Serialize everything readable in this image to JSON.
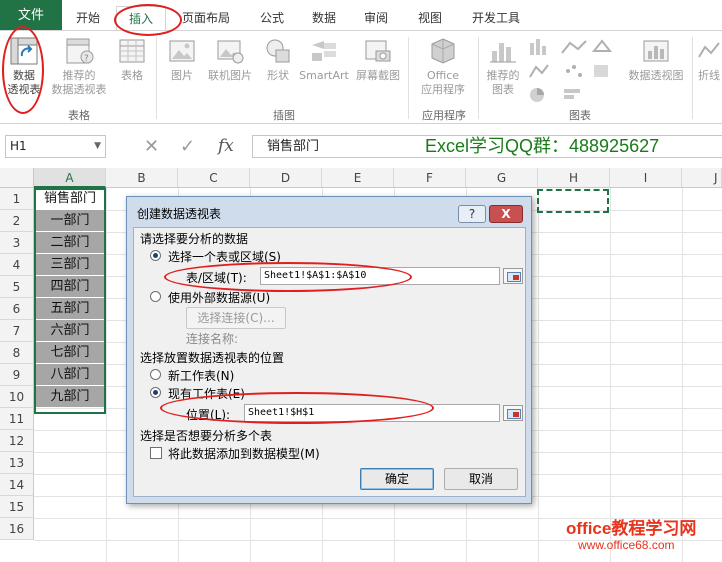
{
  "tabs": {
    "file": "文件",
    "items": [
      "开始",
      "插入",
      "页面布局",
      "公式",
      "数据",
      "审阅",
      "视图",
      "开发工具"
    ]
  },
  "ribbon": {
    "buttons": {
      "pivot_table": [
        "数据",
        "透视表"
      ],
      "recommended_pivot": [
        "推荐的",
        "数据透视表"
      ],
      "table": [
        "表格"
      ],
      "pictures": [
        "图片"
      ],
      "online_pictures": [
        "联机图片"
      ],
      "shapes": [
        "形状"
      ],
      "smartart": [
        "SmartArt"
      ],
      "screenshot": [
        "屏幕截图"
      ],
      "office_apps": [
        "Office",
        "应用程序"
      ],
      "recommended_charts": [
        "推荐的",
        "图表"
      ],
      "pivot_chart": [
        "数据透视图"
      ],
      "sparkline": [
        "折线"
      ]
    },
    "groups": [
      "表格",
      "插图",
      "应用程序",
      "图表"
    ]
  },
  "formula_bar": {
    "name_box": "H1",
    "fx": "fx",
    "content": "销售部门",
    "banner": "Excel学习QQ群：488925627"
  },
  "sheet": {
    "columns": [
      "A",
      "B",
      "C",
      "D",
      "E",
      "F",
      "G",
      "H",
      "I",
      "J"
    ],
    "rows": [
      "1",
      "2",
      "3",
      "4",
      "5",
      "6",
      "7",
      "8",
      "9",
      "10",
      "11",
      "12",
      "13",
      "14",
      "15",
      "16"
    ],
    "column_a": [
      "销售部门",
      "一部门",
      "二部门",
      "三部门",
      "四部门",
      "五部门",
      "六部门",
      "七部门",
      "八部门",
      "九部门"
    ]
  },
  "dialog": {
    "title": "创建数据透视表",
    "help": "?",
    "close": "X",
    "section1": "请选择要分析的数据",
    "option_select_range": "选择一个表或区域(S)",
    "range_label": "表/区域(T):",
    "range_value": "Sheet1!$A$1:$A$10",
    "option_external": "使用外部数据源(U)",
    "choose_connection": "选择连接(C)...",
    "connection_name": "连接名称:",
    "section2": "选择放置数据透视表的位置",
    "option_new_sheet": "新工作表(N)",
    "option_existing_sheet": "现有工作表(E)",
    "location_label": "位置(L):",
    "location_value": "Sheet1!$H$1",
    "section3": "选择是否想要分析多个表",
    "data_model_check": "将此数据添加到数据模型(M)",
    "ok": "确定",
    "cancel": "取消"
  },
  "watermark": {
    "line1": "office教程学习网",
    "line2": "www.office68.com"
  },
  "colors": {
    "excel_green": "#217346",
    "annotation_red": "#e02020",
    "watermark_red": "#e8341c",
    "banner_green": "#1a7a1a"
  }
}
